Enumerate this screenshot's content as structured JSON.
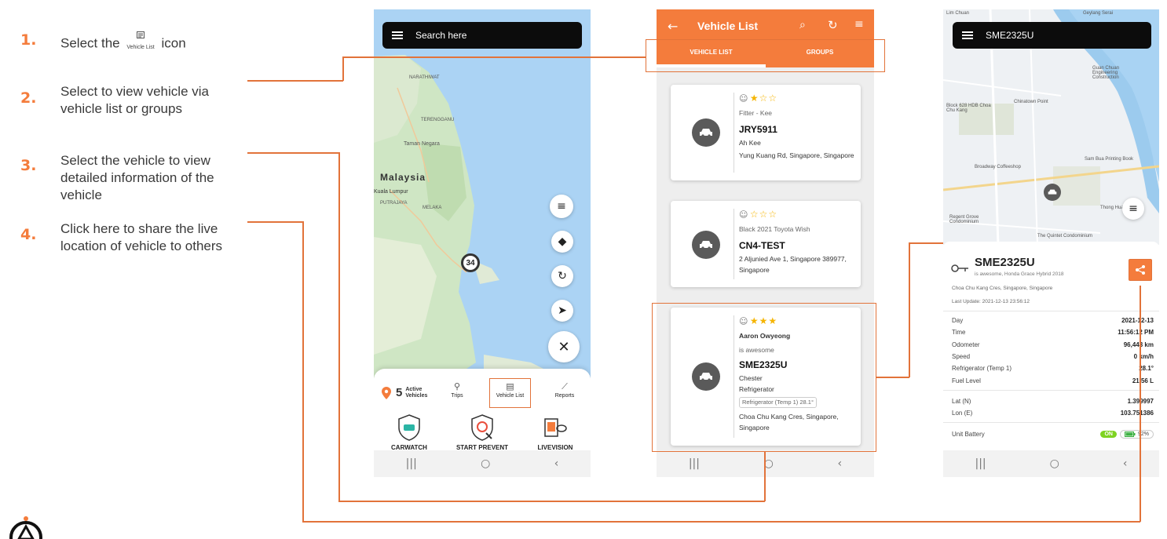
{
  "steps": [
    {
      "num": "1.",
      "text_before": "Select the",
      "icon_label": "Vehicle List",
      "text_after": "icon"
    },
    {
      "num": "2.",
      "text": "Select to view vehicle via vehicle list or groups"
    },
    {
      "num": "3.",
      "text": "Select the vehicle to view detailed information of the vehicle"
    },
    {
      "num": "4.",
      "text": "Click here to share the live location of vehicle to others"
    }
  ],
  "phone1": {
    "search_label": "Search here",
    "map_labels": {
      "country": "Malaysia",
      "kuala_lumpur": "Kuala Lumpur",
      "taman_negara": "Taman Negara",
      "cluster_count": "34"
    },
    "active_count": "5",
    "active_label": "Active Vehicles",
    "tabs": [
      "Trips",
      "Vehicle List",
      "Reports"
    ],
    "features": [
      "CARWATCH",
      "START PREVENT",
      "LIVEVISION"
    ]
  },
  "phone2": {
    "title": "Vehicle List",
    "tabs": [
      "VEHICLE LIST",
      "GROUPS"
    ],
    "vehicles": [
      {
        "rating": "★☆☆",
        "subtitle": "Fitter - Kee",
        "plate": "JRY5911",
        "driver": "Ah Kee",
        "address": "Yung Kuang Rd, Singapore, Singapore"
      },
      {
        "rating": "☆☆☆",
        "subtitle": "Black 2021 Toyota Wish",
        "plate": "CN4-TEST",
        "address": "2 Aljunied Ave 1, Singapore 389977, Singapore"
      },
      {
        "rating": "★★★",
        "subtitle": "Aaron Owyeong",
        "note": "is awesome",
        "plate": "SME2325U",
        "driver": "Chester",
        "type": "Refrigerator",
        "tag": "Refrigerator (Temp 1)  28.1°",
        "address": "Choa Chu Kang Cres, Singapore, Singapore"
      }
    ]
  },
  "phone3": {
    "plate": "SME2325U",
    "map_labels": [
      "Lim Chuan",
      "Geylang Serai",
      "Guan Chuan Engineering Construction",
      "Chinatown Point",
      "Broadway Coffeeshop",
      "Thong Hua",
      "The Quintet Condominium",
      "Regent Grove Condominium",
      "Block 628 HDB Choa Chu Kang",
      "Sam Bua Printing Book"
    ],
    "vehicle_plate": "SME2325U",
    "vehicle_desc": "is awesome, Honda Grace Hybrid 2018",
    "address": "Choa Chu Kang Cres, Singapore, Singapore",
    "last_update": "Last Update: 2021-12-13 23:56:12",
    "details": [
      {
        "label": "Day",
        "value": "2021-12-13"
      },
      {
        "label": "Time",
        "value": "11:56:12 PM"
      },
      {
        "label": "Odometer",
        "value": "96,443 km"
      },
      {
        "label": "Speed",
        "value": "0 km/h"
      },
      {
        "label": "Refrigerator (Temp 1)",
        "value": "28.1°"
      },
      {
        "label": "Fuel Level",
        "value": "21.56 L"
      }
    ],
    "coords": [
      {
        "label": "Lat (N)",
        "value": "1.399997"
      },
      {
        "label": "Lon (E)",
        "value": "103.751386"
      }
    ],
    "battery_label": "Unit Battery",
    "battery_state": "ON",
    "battery_percent": "92%"
  },
  "colors": {
    "accent": "#f47c3c",
    "connector": "#e2733a"
  }
}
